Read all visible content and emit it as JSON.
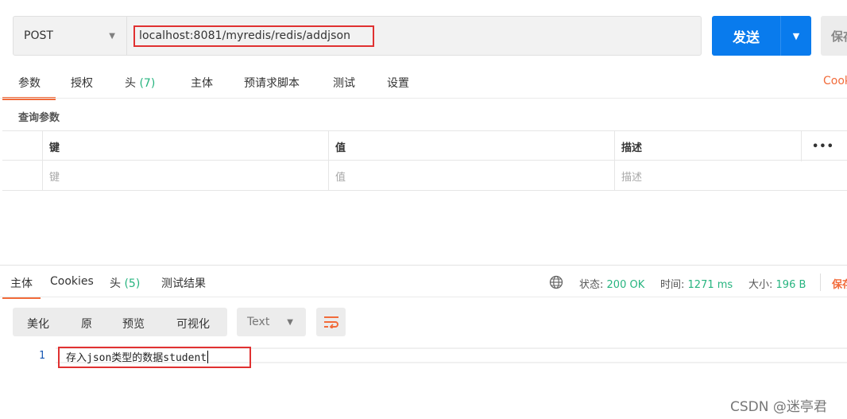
{
  "request": {
    "method": "POST",
    "url": "localhost:8081/myredis/redis/addjson",
    "send_label": "发送",
    "save_label": "保存"
  },
  "request_tabs": {
    "params": "参数",
    "auth": "授权",
    "headers": "头",
    "headers_count": "(7)",
    "body": "主体",
    "prerequest": "预请求脚本",
    "tests": "测试",
    "settings": "设置",
    "cookies": "Cookies"
  },
  "query_params": {
    "section_title": "查询参数",
    "columns": [
      "键",
      "值",
      "描述"
    ],
    "more": "•••",
    "placeholders": [
      "键",
      "值",
      "描述"
    ]
  },
  "response_tabs": {
    "body": "主体",
    "cookies": "Cookies",
    "headers": "头",
    "headers_count": "(5)",
    "test_results": "测试结果"
  },
  "response_status": {
    "status_label": "状态:",
    "status_value": "200 OK",
    "time_label": "时间:",
    "time_value": "1271 ms",
    "size_label": "大小:",
    "size_value": "196 B",
    "save_response": "保存"
  },
  "view_toolbar": {
    "pretty": "美化",
    "raw": "原",
    "preview": "预览",
    "visualize": "可视化",
    "format": "Text"
  },
  "response_body": {
    "line_number": "1",
    "text": "存入json类型的数据student"
  },
  "watermark": "CSDN @迷亭君",
  "colors": {
    "accent": "#f26b3a",
    "send_button": "#097bed",
    "success": "#26b47f",
    "highlight_box": "#e03131"
  }
}
